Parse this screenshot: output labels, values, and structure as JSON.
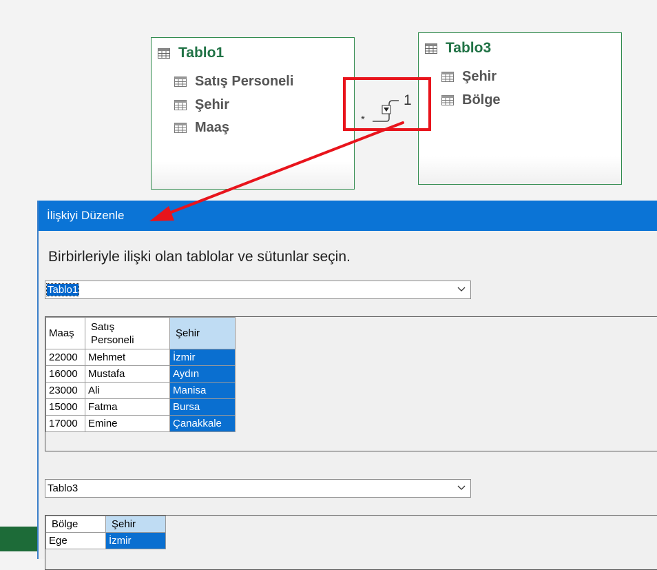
{
  "diagram": {
    "table1": {
      "title": "Tablo1",
      "fields": [
        "Satış Personeli",
        "Şehir",
        "Maaş"
      ]
    },
    "table3": {
      "title": "Tablo3",
      "fields": [
        "Şehir",
        "Bölge"
      ]
    },
    "relationship": {
      "one_label": "1",
      "many_label": "*"
    },
    "colors": {
      "table_title": "#217346",
      "highlight": "#e8141c",
      "arrow": "#e8141c"
    }
  },
  "dialog": {
    "title": "İlişkiyi Düzenle",
    "prompt": "Birbirleriyle ilişki olan tablolar ve sütunlar seçin.",
    "table1_select": {
      "value": "Tablo1"
    },
    "table1_grid": {
      "headers": [
        "Maaş",
        "Satış\nPersoneli",
        "Şehir"
      ],
      "rows": [
        [
          "22000",
          "Mehmet",
          "İzmir"
        ],
        [
          "16000",
          "Mustafa",
          "Aydın"
        ],
        [
          "23000",
          "Ali",
          "Manisa"
        ],
        [
          "15000",
          "Fatma",
          "Bursa"
        ],
        [
          "17000",
          "Emine",
          "Çanakkale"
        ]
      ],
      "selected_column": "Şehir"
    },
    "table2_select": {
      "value": "Tablo3"
    },
    "table2_grid": {
      "headers": [
        "Bölge",
        "Şehir"
      ],
      "rows": [
        [
          "Ege",
          "İzmir"
        ]
      ],
      "selected_column": "Şehir"
    },
    "colors": {
      "titlebar": "#0b74d6",
      "selection": "#0a6fd0",
      "selected_header": "#bfdcf3"
    }
  }
}
